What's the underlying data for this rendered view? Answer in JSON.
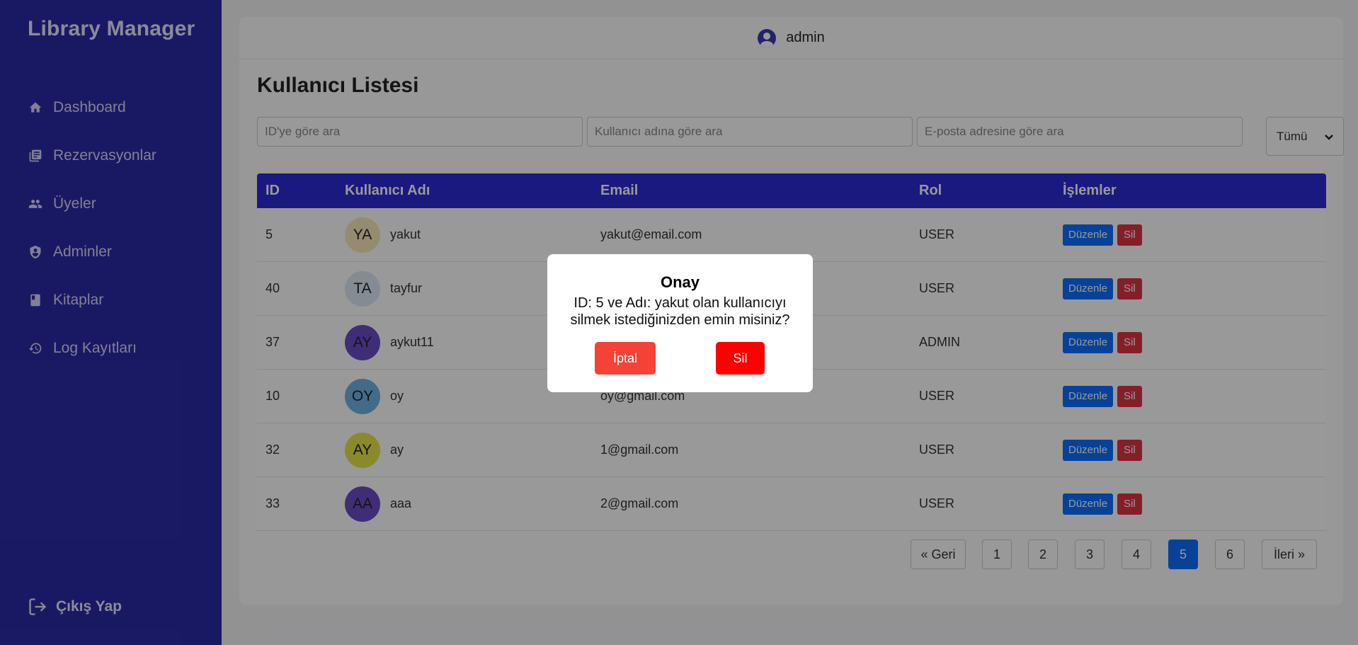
{
  "sidebar": {
    "brand": "Library Manager",
    "items": [
      {
        "label": "Dashboard",
        "icon": "home-icon"
      },
      {
        "label": "Rezervasyonlar",
        "icon": "library-books-icon"
      },
      {
        "label": "Üyeler",
        "icon": "people-icon"
      },
      {
        "label": "Adminler",
        "icon": "admin-shield-icon"
      },
      {
        "label": "Kitaplar",
        "icon": "book-icon"
      },
      {
        "label": "Log Kayıtları",
        "icon": "history-icon"
      }
    ],
    "logout": "Çıkış Yap"
  },
  "topbar": {
    "username": "admin"
  },
  "page": {
    "title": "Kullanıcı Listesi",
    "filters": {
      "id_placeholder": "ID'ye göre ara",
      "name_placeholder": "Kullanıcı adına göre ara",
      "email_placeholder": "E-posta adresine göre ara",
      "role_selected": "Tümü"
    },
    "table": {
      "headers": [
        "ID",
        "Kullanıcı Adı",
        "Email",
        "Rol",
        "İşlemler"
      ],
      "edit_label": "Düzenle",
      "delete_label": "Sil",
      "rows": [
        {
          "id": "5",
          "initials": "YA",
          "name": "yakut",
          "email": "yakut@email.com",
          "role": "USER",
          "avatar_color": "#f5e9b8"
        },
        {
          "id": "40",
          "initials": "TA",
          "name": "tayfur",
          "email": "",
          "role": "USER",
          "avatar_color": "#dde8f3"
        },
        {
          "id": "37",
          "initials": "AY",
          "name": "aykut11",
          "email": "",
          "role": "ADMIN",
          "avatar_color": "#6b4bc7"
        },
        {
          "id": "10",
          "initials": "OY",
          "name": "oy",
          "email": "oy@gmail.com",
          "role": "USER",
          "avatar_color": "#6fb3e6"
        },
        {
          "id": "32",
          "initials": "AY",
          "name": "ay",
          "email": "1@gmail.com",
          "role": "USER",
          "avatar_color": "#e6e64a"
        },
        {
          "id": "33",
          "initials": "AA",
          "name": "aaa",
          "email": "2@gmail.com",
          "role": "USER",
          "avatar_color": "#6b4bc7"
        }
      ]
    },
    "pagination": {
      "prev": "« Geri",
      "pages": [
        "1",
        "2",
        "3",
        "4",
        "5",
        "6"
      ],
      "active": "5",
      "next": "İleri »"
    }
  },
  "modal": {
    "title": "Onay",
    "message": "ID: 5 ve Adı: yakut olan kullanıcıyı silmek istediğinizden emin misiniz?",
    "cancel": "İptal",
    "confirm": "Sil"
  },
  "colors": {
    "sidebar_bg": "#2a2aa6",
    "table_header_bg": "#2a2ad6",
    "primary": "#0d6efd",
    "danger": "#dc3545",
    "modal_cancel": "#f44336",
    "modal_confirm": "#ff0000"
  }
}
